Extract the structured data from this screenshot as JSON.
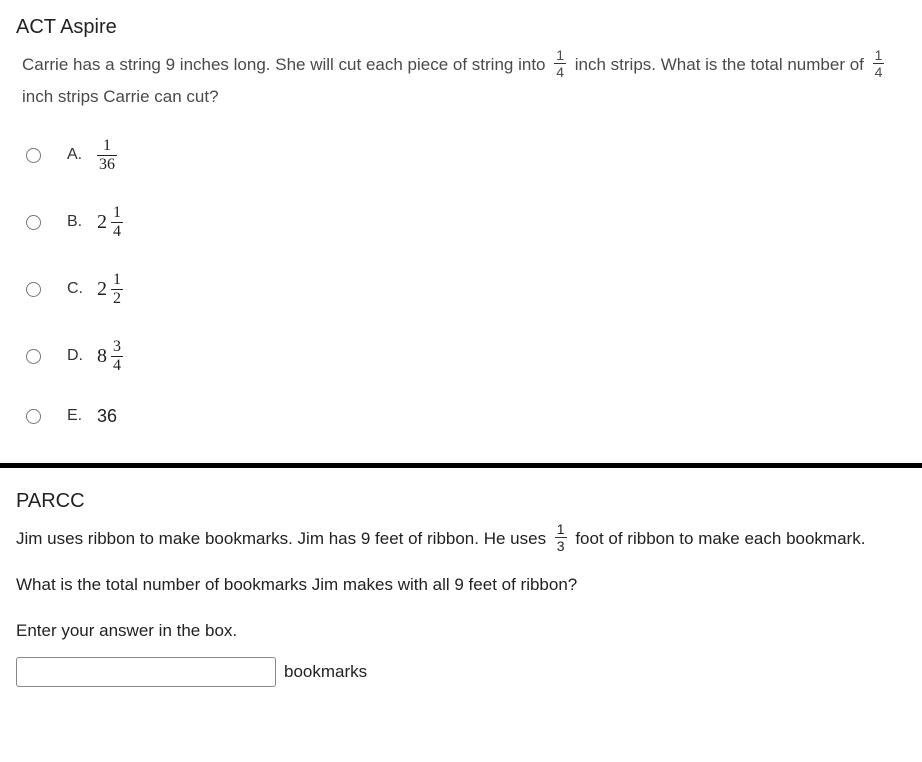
{
  "q1": {
    "title": "ACT Aspire",
    "text_part1": "Carrie has a string 9 inches long. She will cut each piece of string into ",
    "frac1_num": "1",
    "frac1_den": "4",
    "text_part2": " inch strips. What is the total number of ",
    "frac2_num": "1",
    "frac2_den": "4",
    "text_part3": " inch strips Carrie can cut?",
    "answers": {
      "a": {
        "letter": "A.",
        "frac_num": "1",
        "frac_den": "36"
      },
      "b": {
        "letter": "B.",
        "whole": "2",
        "frac_num": "1",
        "frac_den": "4"
      },
      "c": {
        "letter": "C.",
        "whole": "2",
        "frac_num": "1",
        "frac_den": "2"
      },
      "d": {
        "letter": "D.",
        "whole": "8",
        "frac_num": "3",
        "frac_den": "4"
      },
      "e": {
        "letter": "E.",
        "value": "36"
      }
    }
  },
  "q2": {
    "title": "PARCC",
    "text_part1": "Jim uses ribbon to make bookmarks. Jim has 9 feet of ribbon. He uses ",
    "frac_num": "1",
    "frac_den": "3",
    "text_part2": " foot of ribbon to make each bookmark.",
    "line2": "What is the total number of bookmarks Jim makes with all 9 feet of ribbon?",
    "line3": "Enter your answer in the box.",
    "unit": "bookmarks"
  }
}
